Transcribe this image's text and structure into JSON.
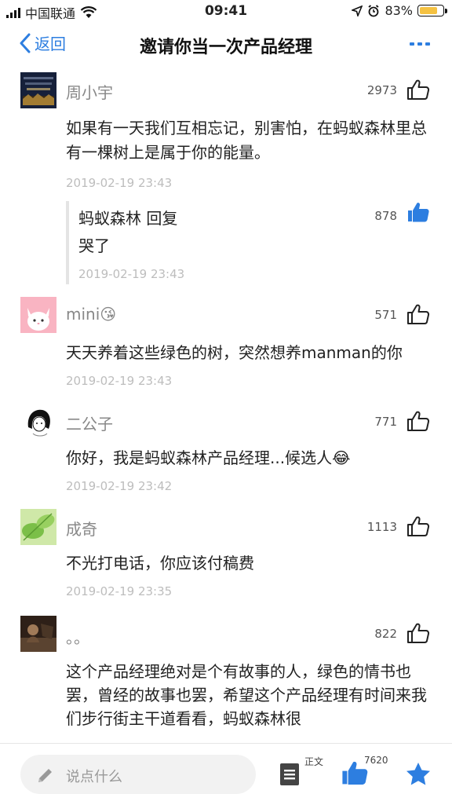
{
  "status_bar": {
    "carrier": "中国联通",
    "time": "09:41",
    "battery": "83%",
    "battery_level": 0.83
  },
  "nav": {
    "back_label": "返回",
    "title": "邀请你当一次产品经理",
    "more_icon": "more-dots-icon"
  },
  "comments": [
    {
      "name": "周小宇",
      "likes": "2973",
      "liked": false,
      "text": "如果有一天我们互相忘记，别害怕，在蚂蚁森林里总有一棵树上是属于你的能量。",
      "time": "2019-02-19 23:43",
      "reply": {
        "header": "蚂蚁森林 回复",
        "likes": "878",
        "liked": true,
        "text": "哭了",
        "time": "2019-02-19 23:43"
      }
    },
    {
      "name": "mini😘",
      "likes": "571",
      "liked": false,
      "text": "天天养着这些绿色的树，突然想养manman的你",
      "time": "2019-02-19 23:43"
    },
    {
      "name": "二公子",
      "likes": "771",
      "liked": false,
      "text": "你好，我是蚂蚁森林产品经理...候选人😂",
      "time": "2019-02-19 23:42"
    },
    {
      "name": "成奇",
      "likes": "1113",
      "liked": false,
      "text": "不光打电话，你应该付稿费",
      "time": "2019-02-19 23:35"
    },
    {
      "name": "。。",
      "likes": "822",
      "liked": false,
      "text": "这个产品经理绝对是个有故事的人，绿色的情书也罢，曾经的故事也罢，希望这个产品经理有时间来我们步行街主干道看看，蚂蚁森林很"
    }
  ],
  "bottom_bar": {
    "input_placeholder": "说点什么",
    "doc_label": "正文",
    "like_count": "7620"
  },
  "colors": {
    "accent": "#2d7ee0",
    "muted_text": "#888888",
    "timestamp": "#bdbdbd",
    "battery_fill": "#f5c242"
  }
}
